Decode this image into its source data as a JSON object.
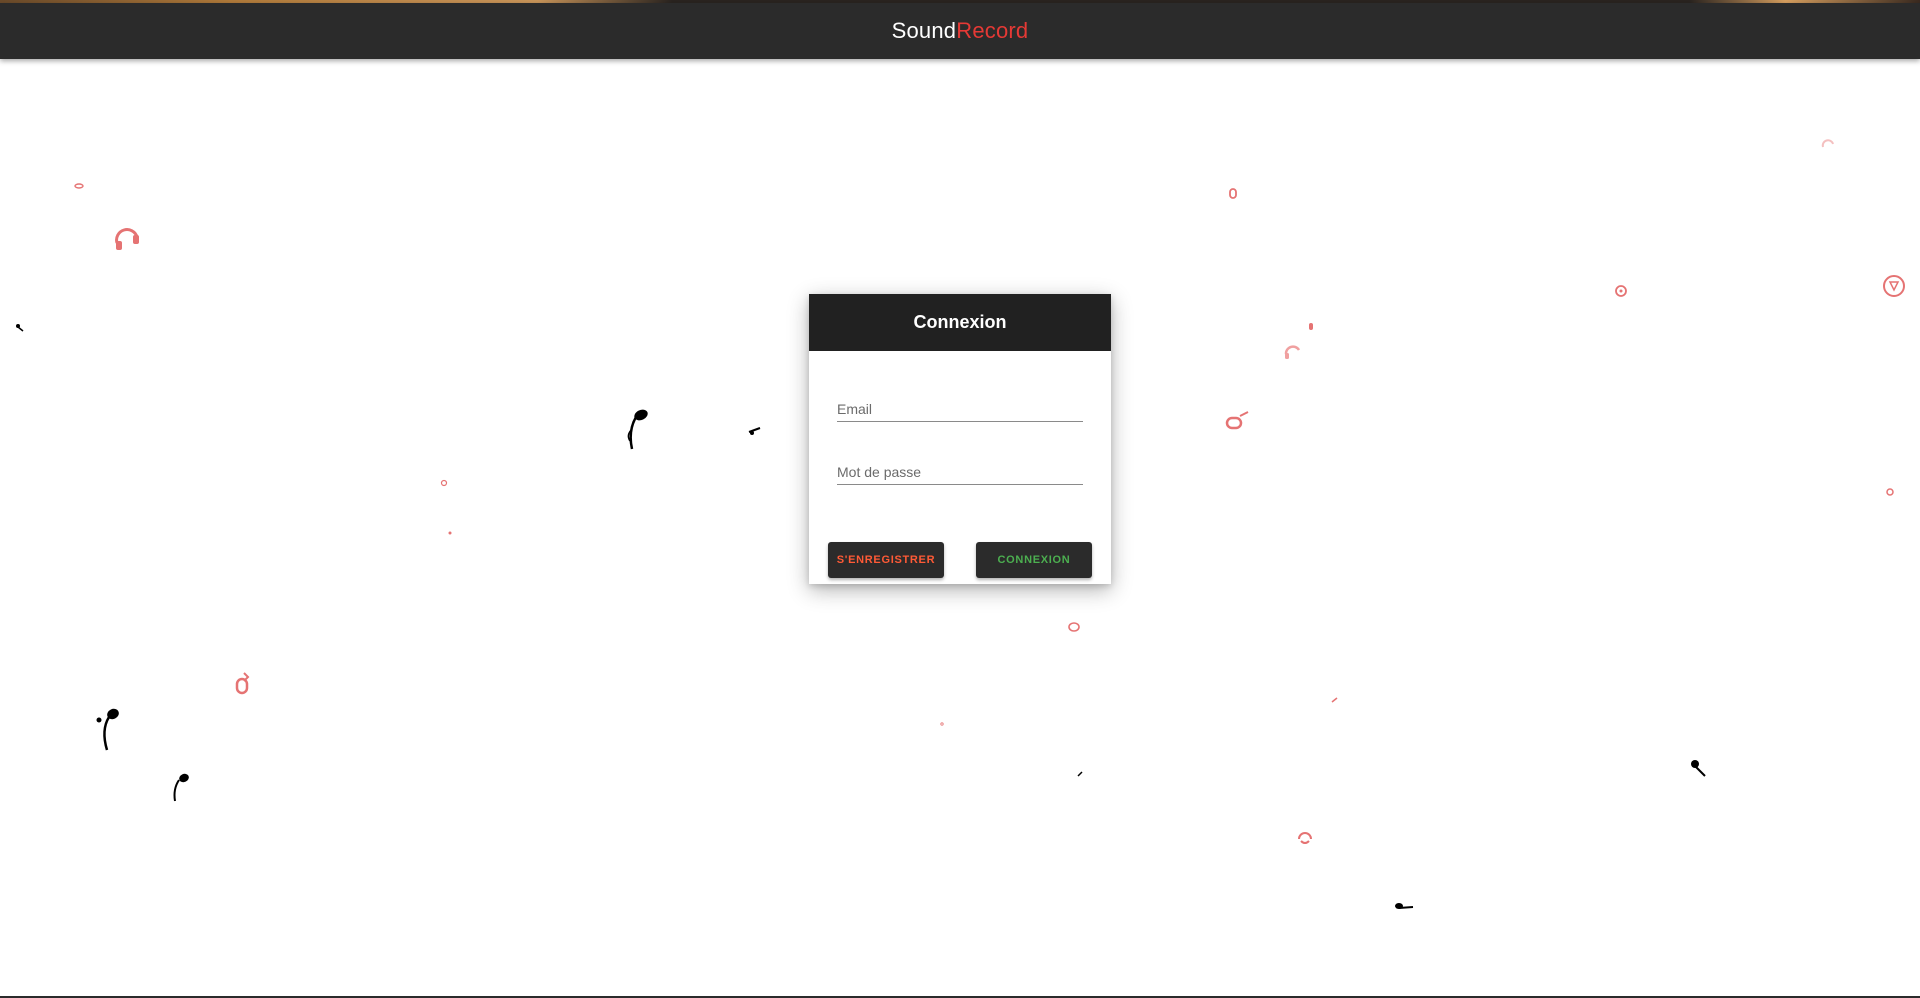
{
  "app": {
    "brand_primary": "Sound",
    "brand_accent": "Record",
    "accent_color": "#e53935"
  },
  "login": {
    "title": "Connexion",
    "email_placeholder": "Email",
    "password_placeholder": "Mot de passe",
    "register_label": "S'ENREGISTRER",
    "login_label": "CONNEXION",
    "register_color": "#ff5a36",
    "login_color": "#4caf50"
  },
  "decorations": {
    "icons": [
      "music-note-icon",
      "microphone-icon",
      "headphones-icon",
      "vinyl-disc-icon"
    ]
  }
}
